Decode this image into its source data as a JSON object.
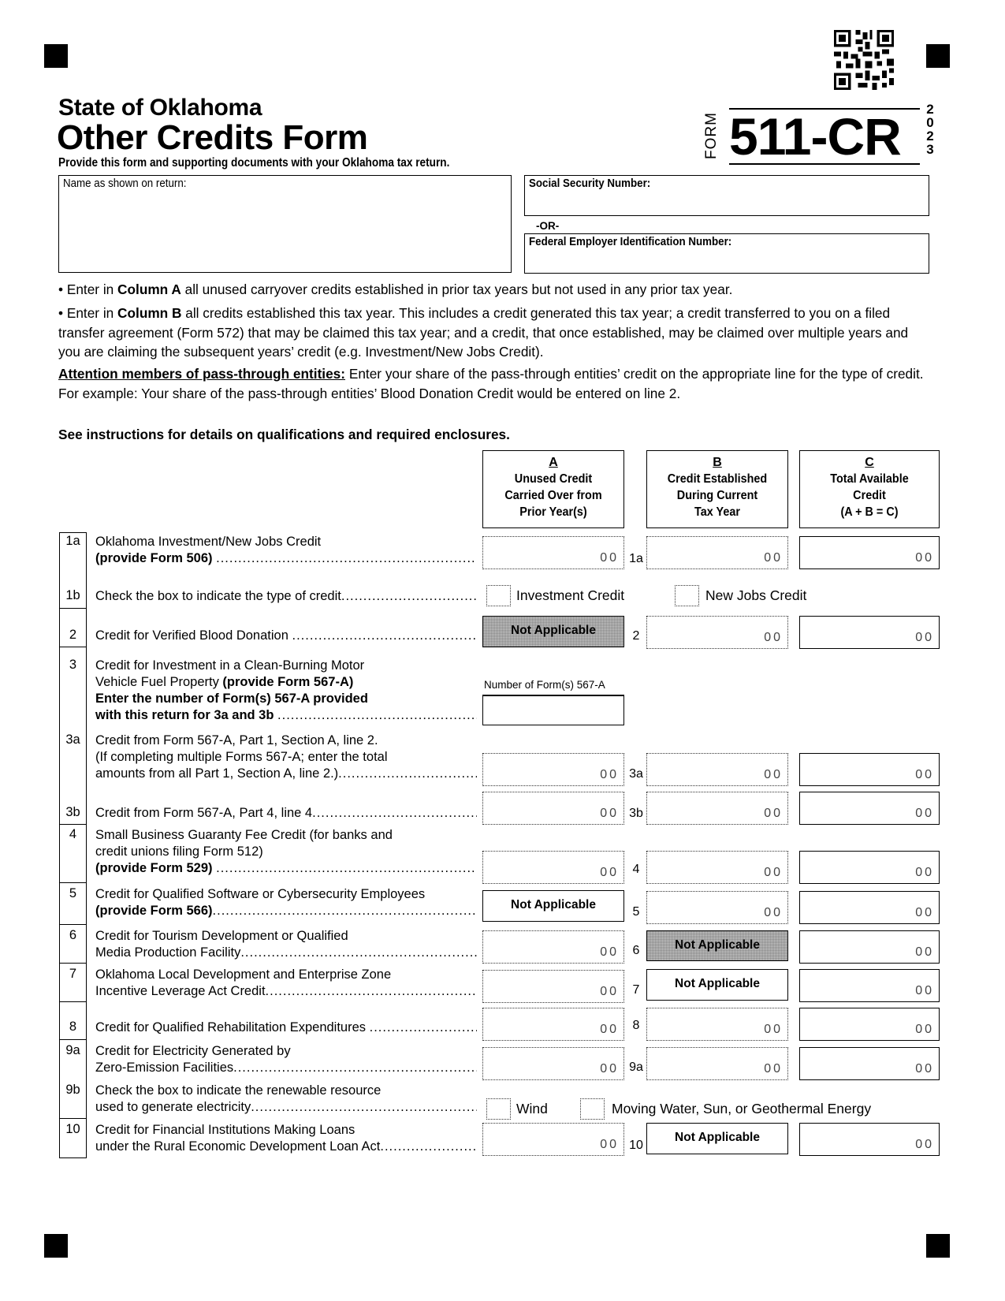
{
  "header": {
    "state": "State of Oklahoma",
    "title": "Other Credits Form",
    "subtitle": "Provide this form and supporting documents with your Oklahoma tax return.",
    "form_word": "FORM",
    "form_number": "511-CR",
    "year_digits": [
      "2",
      "0",
      "2",
      "3"
    ],
    "qr_code_icon": "qr-code"
  },
  "identity": {
    "name_label": "Name as shown on return:",
    "name_value": "",
    "ssn_label": "Social Security Number:",
    "ssn_value": "",
    "or_label": "-OR-",
    "fein_label": "Federal Employer Identification Number:",
    "fein_value": ""
  },
  "instructions": {
    "col_a_prefix": "• Enter in ",
    "col_a_bold": "Column A",
    "col_a_rest": " all unused carryover credits established in prior tax years but not used in any prior tax year.",
    "col_b_prefix": "• Enter in ",
    "col_b_bold": "Column B",
    "col_b_rest": " all credits established this tax year. This includes a credit generated this tax year; a credit transferred to you on a filed transfer agreement (Form 572) that may be claimed this tax year; and a credit, that once established, may be claimed over multiple years and you are claiming the subsequent years’ credit (e.g. Investment/New Jobs Credit).",
    "attention_bold": "Attention members of pass-through entities:",
    "attention_rest": " Enter your share of the pass-through entities’ credit on the appropriate line for the type of credit. For example: Your share of the pass-through entities’ Blood Donation Credit would be entered on line 2.",
    "see_instructions": "See instructions for details on qualifications and required enclosures."
  },
  "columns": [
    {
      "letter": "A",
      "lines": [
        "Unused Credit",
        "Carried Over from",
        "Prior Year(s)"
      ]
    },
    {
      "letter": "B",
      "lines": [
        "Credit Established",
        "During Current",
        "Tax Year"
      ]
    },
    {
      "letter": "C",
      "lines": [
        "Total Available",
        "Credit",
        "(A + B = C)"
      ]
    }
  ],
  "cents_placeholder": "00",
  "not_applicable": "Not Applicable",
  "lines": {
    "l1a": {
      "num": "1a",
      "text1": "Oklahoma Investment/New Jobs Credit",
      "text2_bold": "(provide Form 506)",
      "mid": "1a"
    },
    "l1b": {
      "num": "1b",
      "text": "Check the box to indicate the type of credit",
      "opt1": "Investment Credit",
      "opt2": "New Jobs Credit"
    },
    "l2": {
      "num": "2",
      "text": "Credit for Verified Blood Donation",
      "mid": "2"
    },
    "l3": {
      "num": "3",
      "text1": "Credit for Investment in a Clean-Burning Motor",
      "text2": "Vehicle Fuel Property ",
      "text2_bold": "(provide Form 567-A)",
      "text3_bold": "Enter the number of Form(s) 567-A provided",
      "text4_bold": "with this return for 3a and 3b",
      "count_label": "Number of Form(s) 567-A",
      "count_value": ""
    },
    "l3a": {
      "num": "3a",
      "text1": "Credit from Form 567-A, Part 1, Section A, line 2.",
      "text2": "(If completing multiple Forms 567-A; enter the total",
      "text3": "amounts from all Part 1, Section A, line 2.)",
      "mid": "3a"
    },
    "l3b": {
      "num": "3b",
      "text": "Credit from Form 567-A, Part 4, line 4",
      "mid": "3b"
    },
    "l4": {
      "num": "4",
      "text1": "Small Business Guaranty Fee Credit (for banks and",
      "text2": "credit unions filing Form 512)",
      "text3_bold": "(provide Form 529)",
      "mid": "4"
    },
    "l5": {
      "num": "5",
      "text1": "Credit for Qualified Software or Cybersecurity Employees",
      "text2_bold": "(provide Form 566)",
      "mid": "5"
    },
    "l6": {
      "num": "6",
      "text1": "Credit for Tourism Development or Qualified",
      "text2": "Media Production Facility",
      "mid": "6"
    },
    "l7": {
      "num": "7",
      "text1": "Oklahoma Local Development and Enterprise Zone",
      "text2": "Incentive Leverage Act Credit",
      "mid": "7"
    },
    "l8": {
      "num": "8",
      "text": "Credit for Qualified Rehabilitation Expenditures",
      "mid": "8"
    },
    "l9a": {
      "num": "9a",
      "text1": "Credit for Electricity Generated by",
      "text2": "Zero-Emission Facilities",
      "mid": "9a"
    },
    "l9b": {
      "num": "9b",
      "text1": "Check the box to indicate the renewable resource",
      "text2": "used to generate electricity",
      "opt1": "Wind",
      "opt2": "Moving Water, Sun, or Geothermal Energy"
    },
    "l10": {
      "num": "10",
      "text1": "Credit for Financial Institutions Making Loans",
      "text2": "under the Rural Economic Development Loan Act",
      "mid": "10"
    }
  },
  "leader_dots": "................................................................................................................"
}
